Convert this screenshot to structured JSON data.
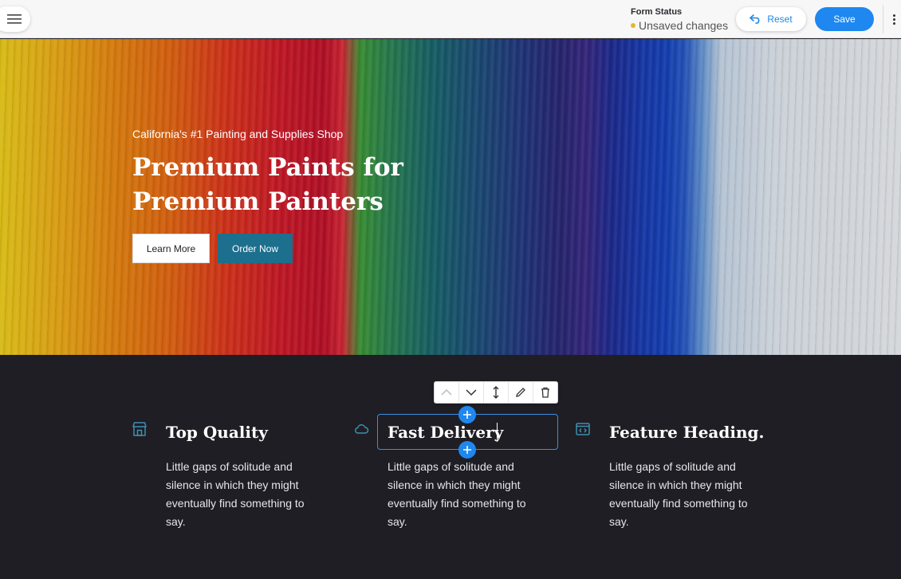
{
  "topbar": {
    "form_status_label": "Form Status",
    "form_status_value": "Unsaved changes",
    "status_dot_color": "#e6b62d",
    "reset_label": "Reset",
    "save_label": "Save",
    "accent_color": "#1e88f0"
  },
  "hero": {
    "eyebrow": "California's #1 Painting and Supplies Shop",
    "title": "Premium Paints for Premium Painters",
    "primary_cta": "Learn More",
    "secondary_cta": "Order Now"
  },
  "features": [
    {
      "icon": "store-icon",
      "title": "Top Quality",
      "text": "Little gaps of solitude and silence in which they might eventually find something to say."
    },
    {
      "icon": "cloud-icon",
      "title": "Fast Delivery",
      "text": "Little gaps of solitude and silence in which they might eventually find something to say."
    },
    {
      "icon": "code-window-icon",
      "title": "Feature Heading.",
      "text": "Little gaps of solitude and silence in which they might eventually find something to say."
    }
  ],
  "block_toolbar": {
    "actions": [
      "move-up",
      "move-down",
      "drag-reorder",
      "edit",
      "delete"
    ]
  }
}
